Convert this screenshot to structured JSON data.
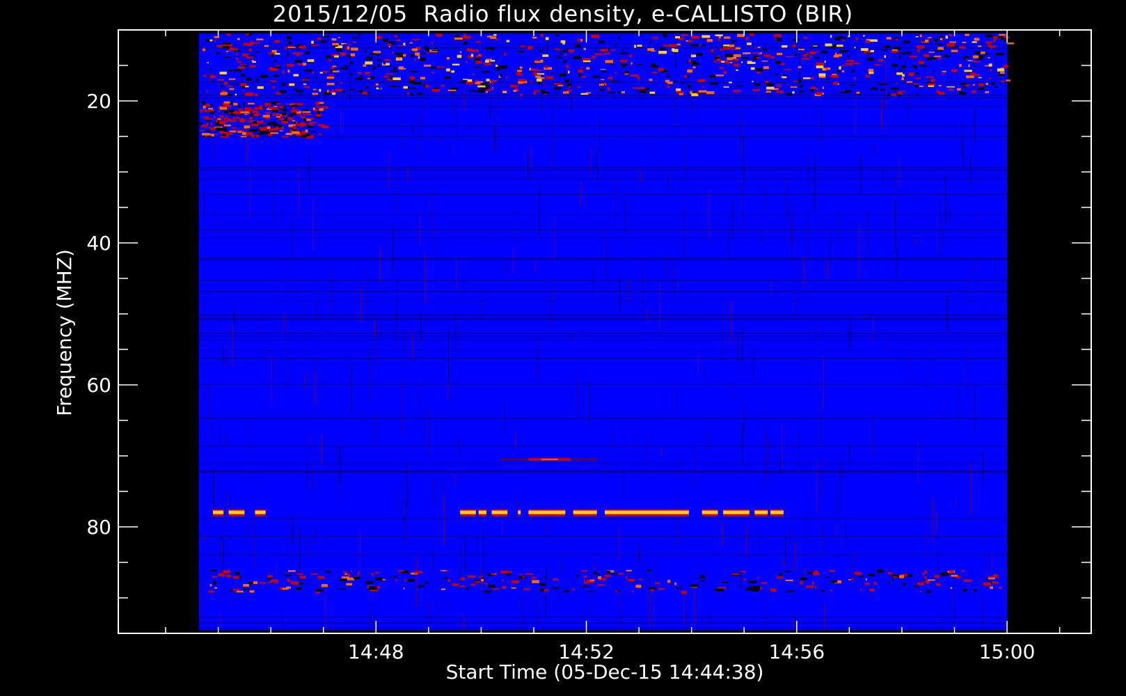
{
  "chart_data": {
    "type": "heatmap",
    "title": "2015/12/05  Radio flux density, e-CALLISTO (BIR)",
    "xlabel": "Start Time (05-Dec-15 14:44:38)",
    "ylabel": "Frequency (MHZ)",
    "x_start_minutes": 884.6333,
    "x_end_minutes": 900.0,
    "xlim_minutes": [
      883.1,
      901.6
    ],
    "ylim": [
      95,
      10
    ],
    "data_freq_range": [
      10.5,
      94.5
    ],
    "x_major_ticks": [
      {
        "label": "14:48",
        "value": 888
      },
      {
        "label": "14:52",
        "value": 892
      },
      {
        "label": "14:56",
        "value": 896
      },
      {
        "label": "15:00",
        "value": 900
      }
    ],
    "x_minor_step_minutes": 1,
    "y_major_ticks": [
      {
        "label": "20",
        "value": 20
      },
      {
        "label": "40",
        "value": 40
      },
      {
        "label": "60",
        "value": 60
      },
      {
        "label": "80",
        "value": 80
      }
    ],
    "y_minor_step": 5,
    "colors": {
      "background": "#000000",
      "axes": "#ffffff",
      "low": "#0000ff",
      "mid": "#cc0000",
      "high": "#ffcc33"
    },
    "features": [
      {
        "name": "interference band",
        "freq_min": 10.5,
        "freq_max": 19,
        "time_start": 884.6333,
        "time_end": 900.0,
        "intensity": "high"
      },
      {
        "name": "weak band",
        "freq_min": 20,
        "freq_max": 25,
        "time_start": 884.6333,
        "time_end": 887.0,
        "intensity": "medium"
      },
      {
        "name": "narrowband burst",
        "freq": 70.5,
        "time_start": 890.9,
        "time_end": 891.7,
        "intensity": "high"
      },
      {
        "name": "intermittent carrier",
        "freq": 78,
        "segments": [
          [
            884.9,
            885.1
          ],
          [
            885.2,
            885.5
          ],
          [
            885.7,
            885.9
          ],
          [
            889.6,
            889.9
          ],
          [
            889.95,
            890.1
          ],
          [
            890.2,
            890.5
          ],
          [
            890.7,
            890.75
          ],
          [
            890.9,
            891.6
          ],
          [
            891.75,
            892.2
          ],
          [
            892.35,
            893.95
          ],
          [
            894.2,
            894.5
          ],
          [
            894.6,
            895.1
          ],
          [
            895.2,
            895.45
          ],
          [
            895.5,
            895.75
          ]
        ],
        "intensity": "high"
      },
      {
        "name": "noise band",
        "freq_min": 86,
        "freq_max": 89,
        "time_start": 884.6333,
        "time_end": 900.0,
        "intensity": "medium"
      }
    ]
  }
}
